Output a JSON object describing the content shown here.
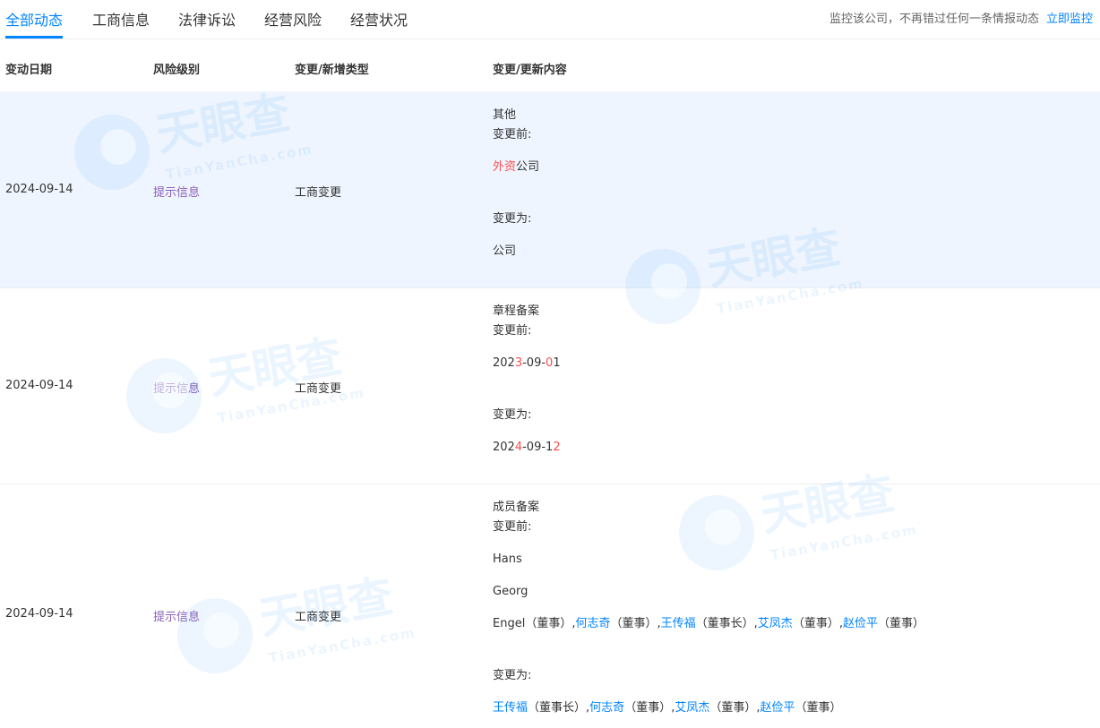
{
  "tabs": [
    "全部动态",
    "工商信息",
    "法律诉讼",
    "经营风险",
    "经营状况"
  ],
  "monitor": {
    "text": "监控该公司，不再错过任何一条情报动态",
    "link": "立即监控"
  },
  "table": {
    "headers": [
      "变动日期",
      "风险级别",
      "变更/新增类型",
      "变更/更新内容"
    ]
  },
  "rows": [
    {
      "date": "2024-09-14",
      "risk": "提示信息",
      "type": "工商变更",
      "category": "其他",
      "before_label": "变更前:",
      "after_label": "变更为:",
      "before_red": "外资",
      "before_rest": "公司",
      "after": "公司"
    },
    {
      "date": "2024-09-14",
      "risk": "提示信息",
      "type": "工商变更",
      "category": "章程备案",
      "before_label": "变更前:",
      "after_label": "变更为:",
      "before_parts": [
        "202",
        "3",
        "-09-",
        "0",
        "1"
      ],
      "after_parts": [
        "202",
        "4",
        "-09-1",
        "2"
      ]
    },
    {
      "date": "2024-09-14",
      "risk": "提示信息",
      "type": "工商变更",
      "category": "成员备案",
      "before_label": "变更前:",
      "after_label": "变更为:",
      "before_line1": "Hans",
      "before_line2": "Georg",
      "before_line3_start": "Engel（董事）,",
      "before_people": [
        {
          "name": "何志奇",
          "role": "（董事）"
        },
        {
          "name": "王传福",
          "role": "（董事长）"
        },
        {
          "name": "艾凤杰",
          "role": "（董事）"
        },
        {
          "name": "赵俭平",
          "role": "（董事）"
        }
      ],
      "after_people": [
        {
          "name": "王传福",
          "role": "（董事长）"
        },
        {
          "name": "何志奇",
          "role": "（董事）"
        },
        {
          "name": "艾凤杰",
          "role": "（董事）"
        },
        {
          "name": "赵俭平",
          "role": "（董事）"
        }
      ]
    }
  ],
  "watermark": {
    "logo": "天眼查",
    "domain": "TianYanCha.com"
  },
  "colors": {
    "accent": "#0084ff",
    "risk": "#8a5fb8",
    "highlight": "#ff4d4f",
    "row_bg": "#eef5fe"
  }
}
